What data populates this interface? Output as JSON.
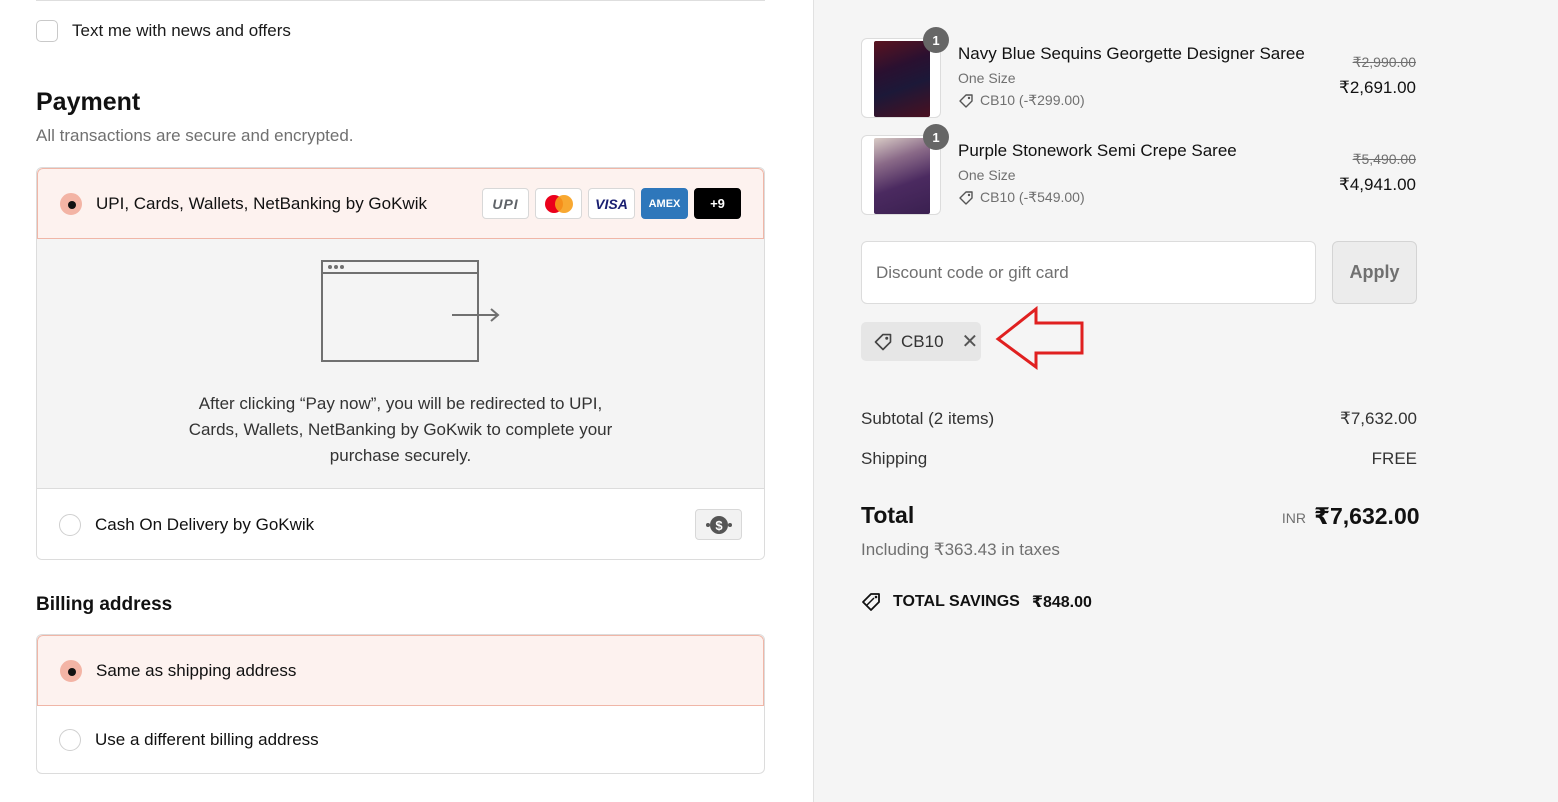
{
  "contact": {
    "news_opt_in_label": "Text me with news and offers"
  },
  "payment": {
    "title": "Payment",
    "subtitle": "All transactions are secure and encrypted.",
    "options": [
      {
        "label": "UPI, Cards, Wallets, NetBanking by GoKwik",
        "selected": true
      },
      {
        "label": "Cash On Delivery by GoKwik",
        "selected": false
      }
    ],
    "card_logos": [
      "UPI",
      "mastercard",
      "VISA",
      "AMEX",
      "+9"
    ],
    "redirect_text": "After clicking “Pay now”, you will be redirected to UPI, Cards, Wallets, NetBanking by GoKwik to complete your purchase securely."
  },
  "billing": {
    "title": "Billing address",
    "options": [
      {
        "label": "Same as shipping address",
        "selected": true
      },
      {
        "label": "Use a different billing address",
        "selected": false
      }
    ]
  },
  "order": {
    "items": [
      {
        "name": "Navy Blue Sequins Georgette Designer Saree",
        "variant": "One Size",
        "discount": "CB10 (-₹299.00)",
        "original_price": "₹2,990.00",
        "price": "₹2,691.00",
        "quantity": "1"
      },
      {
        "name": "Purple Stonework Semi Crepe Saree",
        "variant": "One Size",
        "discount": "CB10 (-₹549.00)",
        "original_price": "₹5,490.00",
        "price": "₹4,941.00",
        "quantity": "1"
      }
    ],
    "discount_placeholder": "Discount code or gift card",
    "apply_label": "Apply",
    "applied_code": "CB10",
    "subtotal_label": "Subtotal (2 items)",
    "subtotal_value": "₹7,632.00",
    "shipping_label": "Shipping",
    "shipping_value": "FREE",
    "total_label": "Total",
    "total_currency": "INR",
    "total_value": "₹7,632.00",
    "tax_line": "Including ₹363.43 in taxes",
    "savings_label": "TOTAL SAVINGS",
    "savings_value": "₹848.00"
  },
  "colors": {
    "selected_bg": "#fdf2ef",
    "selected_border": "#f0b6a7",
    "annotation_arrow": "#e02020"
  }
}
